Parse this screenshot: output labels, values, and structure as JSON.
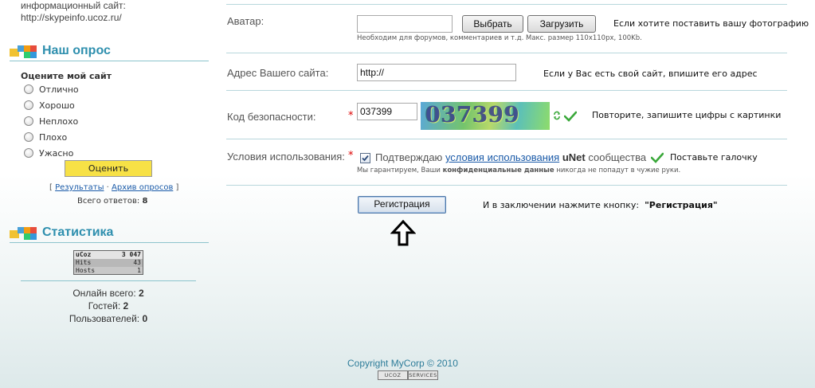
{
  "sidebar": {
    "site_line1": "информационный сайт:",
    "site_line2": "http://skypeinfo.ucoz.ru/",
    "poll": {
      "title": "Наш опрос",
      "question": "Оцените мой сайт",
      "options": [
        "Отлично",
        "Хорошо",
        "Неплохо",
        "Плохо",
        "Ужасно"
      ],
      "vote_label": "Оценить",
      "results_link": "Результаты",
      "archive_link": "Архив опросов",
      "bracket_open": "[",
      "bracket_close": "]",
      "separator": "·",
      "total_label": "Всего ответов:",
      "total_value": "8"
    },
    "stats": {
      "title": "Статистика",
      "counter": {
        "brand": "uCoz",
        "total": "3 047",
        "hits_label": "Hits",
        "hits": "43",
        "hosts_label": "Hosts",
        "hosts": "1"
      },
      "online_label": "Онлайн всего:",
      "online": "2",
      "guests_label": "Гостей:",
      "guests": "2",
      "users_label": "Пользователей:",
      "users": "0"
    }
  },
  "form": {
    "avatar": {
      "label": "Аватар:",
      "value": "",
      "browse_label": "Выбрать",
      "upload_label": "Загрузить",
      "hint": "Если хотите поставить вашу фотографию",
      "note": "Необходим для форумов, комментариев и т.д. Макс. размер 110x110px, 100Kb."
    },
    "website": {
      "label": "Адрес Вашего сайта:",
      "value": "http://",
      "hint": "Если у Вас есть свой сайт, впишите его адрес"
    },
    "security": {
      "label": "Код безопасности:",
      "required_mark": "*",
      "value": "037399",
      "captcha_text": "037399",
      "hint": "Повторите, запишите цифры с картинки"
    },
    "terms": {
      "label": "Условия использования:",
      "required_mark": "*",
      "checked": true,
      "prefix": "Подтверждаю",
      "link": "условия использования",
      "brand": "uNet",
      "suffix": "сообщества",
      "hint": "Поставьте галочку",
      "note_prefix": "Мы гарантируем, Ваши",
      "note_bold": "конфиденциальные данные",
      "note_suffix": "никогда не попадут в чужие руки."
    },
    "submit": {
      "label": "Регистрация",
      "hint_prefix": "И в заключении нажмите кнопку:",
      "hint_button": "\"Регистрация\""
    }
  },
  "footer": {
    "copyright": "Copyright MyCorp © 2010",
    "badge_left": "UCOZ",
    "badge_right": "SERVICES"
  },
  "colors": {
    "accent": "#2e8fae",
    "vote_button": "#f7e146",
    "check": "#3aa83a",
    "link": "#1a5aa8"
  }
}
